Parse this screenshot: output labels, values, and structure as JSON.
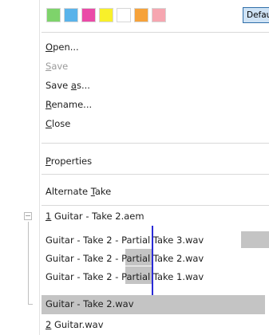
{
  "swatch_colors": [
    "#7ed36b",
    "#5ab3ea",
    "#ea4aa7",
    "#f8f02a",
    "#ffffff",
    "#f6a23a",
    "#f6a6b0"
  ],
  "default_button": "Default",
  "menu": {
    "open": {
      "u": "O",
      "rest": "pen..."
    },
    "save": {
      "u": "S",
      "rest": "ave"
    },
    "save_as": {
      "pre": "Save ",
      "u": "a",
      "rest": "s..."
    },
    "rename": {
      "u": "R",
      "rest": "ename..."
    },
    "close": {
      "u": "C",
      "rest": "lose"
    },
    "properties": {
      "u": "P",
      "rest": "roperties"
    },
    "alternate_take": {
      "pre": "Alternate ",
      "u": "T",
      "rest": "ake"
    }
  },
  "takes": {
    "group1": {
      "u": "1",
      "rest": " Guitar - Take 2.aem"
    },
    "file1": "Guitar - Take 2 - Partial Take 3.wav",
    "file2": "Guitar - Take 2 - Partial Take 2.wav",
    "file3": "Guitar - Take 2 - Partial Take 1.wav",
    "file4": "Guitar - Take 2.wav",
    "group2": {
      "u": "2",
      "rest": " Guitar.wav"
    }
  }
}
